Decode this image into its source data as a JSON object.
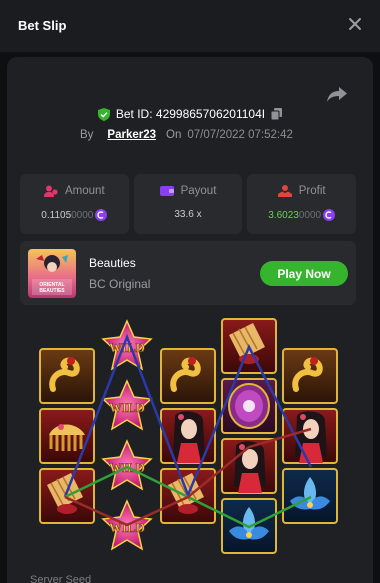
{
  "header": {
    "title": "Bet Slip"
  },
  "bet": {
    "id_label": "Bet ID: 4299865706201104I",
    "by": "By",
    "user": "Parker23",
    "on": "On",
    "date": "07/07/2022 07:52:42"
  },
  "stats": {
    "amount": {
      "label": "Amount",
      "value": "0.1105",
      "trail": "0000"
    },
    "payout": {
      "label": "Payout",
      "value": "33.6 x"
    },
    "profit": {
      "label": "Profit",
      "value": "3.6023",
      "trail": "0000"
    }
  },
  "game": {
    "name": "Beauties",
    "provider": "BC Original",
    "play_label": "Play Now",
    "thumb_caption": "ORIENTAL BEAUTIES"
  },
  "reels": {
    "wild_text": "WILD"
  },
  "footer": {
    "partial_text": "Server Seed"
  },
  "colors": {
    "accent_green": "#35b52d",
    "profit_green": "#6cd14b",
    "coin_purple": "#8b3ff0",
    "frame_gold": "#e0b63a",
    "line_blue": "#2c3aa8",
    "line_green": "#2fa03a",
    "line_red": "#9c2a2a"
  }
}
